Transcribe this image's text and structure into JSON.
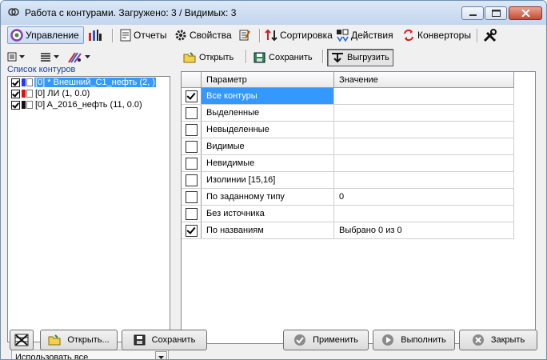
{
  "window": {
    "title": "Работа с контурами. Загружено: 3 / Видимых: 3"
  },
  "toolbar": {
    "items": [
      {
        "label": "Управление",
        "icon": "dial-icon"
      },
      {
        "label": "",
        "icon": "chart-columns-icon"
      },
      {
        "label": "Отчеты",
        "icon": "report-icon"
      },
      {
        "label": "Свойства",
        "icon": "gear-icon"
      },
      {
        "label": "",
        "icon": "edit-icon"
      },
      {
        "label": "Сортировка",
        "icon": "sort-icon"
      },
      {
        "label": "Действия",
        "icon": "actions-icon"
      },
      {
        "label": "Конверторы",
        "icon": "convert-icon"
      },
      {
        "label": "",
        "icon": "tools-icon"
      }
    ],
    "active_index": 0
  },
  "left_panel": {
    "list_label": "Список контуров",
    "items": [
      {
        "text": "[0] * Внешний_С1_нефть (2, )",
        "checked": true,
        "selected": true,
        "color": "#1e3cff"
      },
      {
        "text": "[0] ЛИ (1, 0.0)",
        "checked": true,
        "selected": false,
        "color": "#e01010"
      },
      {
        "text": "[0] A_2016_нефть (11, 0.0)",
        "checked": true,
        "selected": false,
        "color": "#111111"
      }
    ],
    "combo_value": "Использовать все"
  },
  "right_panel": {
    "open_label": "Открыть",
    "save_label": "Сохранить",
    "export_label": "Выгрузить",
    "columns": [
      "Параметр",
      "Значение"
    ],
    "rows": [
      {
        "param": "Все контуры",
        "value": "",
        "checked": true,
        "selected": true
      },
      {
        "param": "Выделенные",
        "value": "",
        "checked": false,
        "selected": false
      },
      {
        "param": "Невыделенные",
        "value": "",
        "checked": false,
        "selected": false
      },
      {
        "param": "Видимые",
        "value": "",
        "checked": false,
        "selected": false
      },
      {
        "param": "Невидимые",
        "value": "",
        "checked": false,
        "selected": false
      },
      {
        "param": "Изолинии [15,16]",
        "value": "",
        "checked": false,
        "selected": false
      },
      {
        "param": "По заданному типу",
        "value": "0",
        "checked": false,
        "selected": false
      },
      {
        "param": "Без источника",
        "value": "",
        "checked": false,
        "selected": false
      },
      {
        "param": "По названиям",
        "value": "Выбрано 0 из 0",
        "checked": true,
        "selected": false
      }
    ]
  },
  "bottom": {
    "open_label": "Открыть...",
    "save_label": "Сохранить",
    "apply_label": "Применить",
    "run_label": "Выполнить",
    "close_label": "Закрыть"
  },
  "colors": {
    "selection": "#3399ff",
    "title_bg": "#c2d6ee",
    "list_label": "#1a3ea0"
  }
}
